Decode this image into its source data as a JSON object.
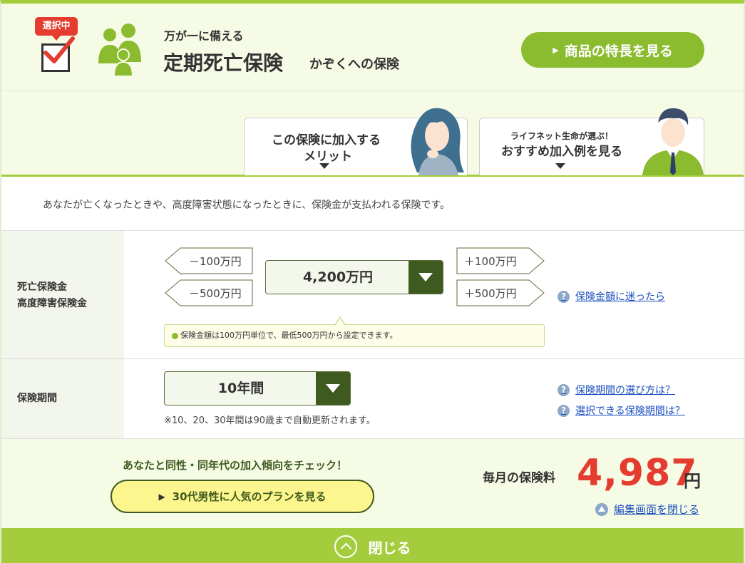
{
  "header": {
    "badge": "選択中",
    "subtitle": "万が一に備える",
    "title": "定期死亡保険",
    "tagline": "かぞくへの保険",
    "feature_button": "商品の特長を見る"
  },
  "tabs": {
    "merit_line1": "この保険に加入する",
    "merit_line2": "メリット",
    "example_line1": "ライフネット生命が選ぶ！",
    "example_line2": "おすすめ加入例を見る"
  },
  "description": "あなたが亡くなったときや、高度障害状態になったときに、保険金が支払われる保険です。",
  "coverage": {
    "label_line1": "死亡保険金",
    "label_line2": "高度障害保険金",
    "minus100": "－100万円",
    "minus500": "－500万円",
    "plus100": "＋100万円",
    "plus500": "＋500万円",
    "amount": "4,200万円",
    "note": "保険金額は100万円単位で、最低500万円から設定できます。",
    "help": "保険金額に迷ったら"
  },
  "period": {
    "label": "保険期間",
    "value": "10年間",
    "note": "※10、20、30年間は90歳まで自動更新されます。",
    "help1": "保険期間の選び方は？",
    "help2": "選択できる保険期間は？"
  },
  "bottom": {
    "trend_text": "あなたと同性・同年代の加入傾向をチェック！",
    "plan_button": "30代男性に人気のプランを見る",
    "premium_label": "毎月の保険料",
    "premium_value": "4,987",
    "premium_unit": "円",
    "close_edit": "編集画面を閉じる"
  },
  "close_bar": "閉じる",
  "colors": {
    "accent_green": "#a4cd3d",
    "button_green": "#8bbb2f",
    "dark_green": "#3e5a1e",
    "price_red": "#e43d2f",
    "link_blue": "#1a4fbf"
  },
  "icons": {
    "checkbox": "checked-checkbox-icon",
    "family": "family-icon",
    "help": "question-circle-icon",
    "close": "chevron-up-circle-icon"
  }
}
